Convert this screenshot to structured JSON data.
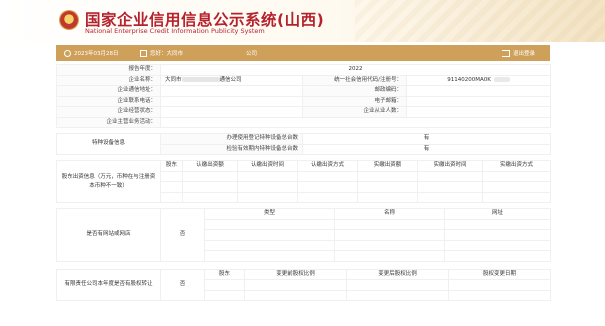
{
  "header": {
    "title": "国家企业信用信息公示系统(山西)",
    "subtitle": "National Enterprise Credit Information Publicity System"
  },
  "toolbar": {
    "date": "2023年03月28日",
    "left_label": "您好：大同市",
    "middle_label": "公司",
    "logout_label": "退出登录"
  },
  "report": {
    "year_label": "报告年度：",
    "year_value": "2022",
    "name_label": "企业名称：",
    "name_value_left": "大同市",
    "name_value_right": "通信公司",
    "credit_label": "统一社会信用代码/注册号：",
    "credit_value": "91140200MA0K",
    "address_label": "企业通信地址：",
    "postcode_label": "邮政编码：",
    "phone_label": "企业联系电话：",
    "email_label": "电子邮箱：",
    "status_label": "企业经营状态：",
    "employees_label": "企业从业人数：",
    "main_business_label": "企业主营业务活动："
  },
  "special_equipment": {
    "label": "特种设备信息",
    "rows": [
      {
        "label": "办理使用登记特种设备总台数",
        "value": "有"
      },
      {
        "label": "检验有效期内特种设备总台数",
        "value": "有"
      }
    ]
  },
  "investment": {
    "label": "股东出资信息（万元，币种在与注册资本币种不一致）",
    "headers": [
      "股东",
      "认缴出资额",
      "认缴出资时间",
      "认缴出资方式",
      "实缴出资额",
      "实缴出资时间",
      "实缴出资方式"
    ]
  },
  "website": {
    "label": "是否有网站或网店",
    "value": "否",
    "headers": [
      "类型",
      "名称",
      "网址"
    ]
  },
  "equity": {
    "label": "有限责任公司本年度是否有股权转让",
    "value": "否",
    "headers": [
      "股东",
      "变更前股权比例",
      "变更后股权比例",
      "股权变更日期"
    ]
  }
}
